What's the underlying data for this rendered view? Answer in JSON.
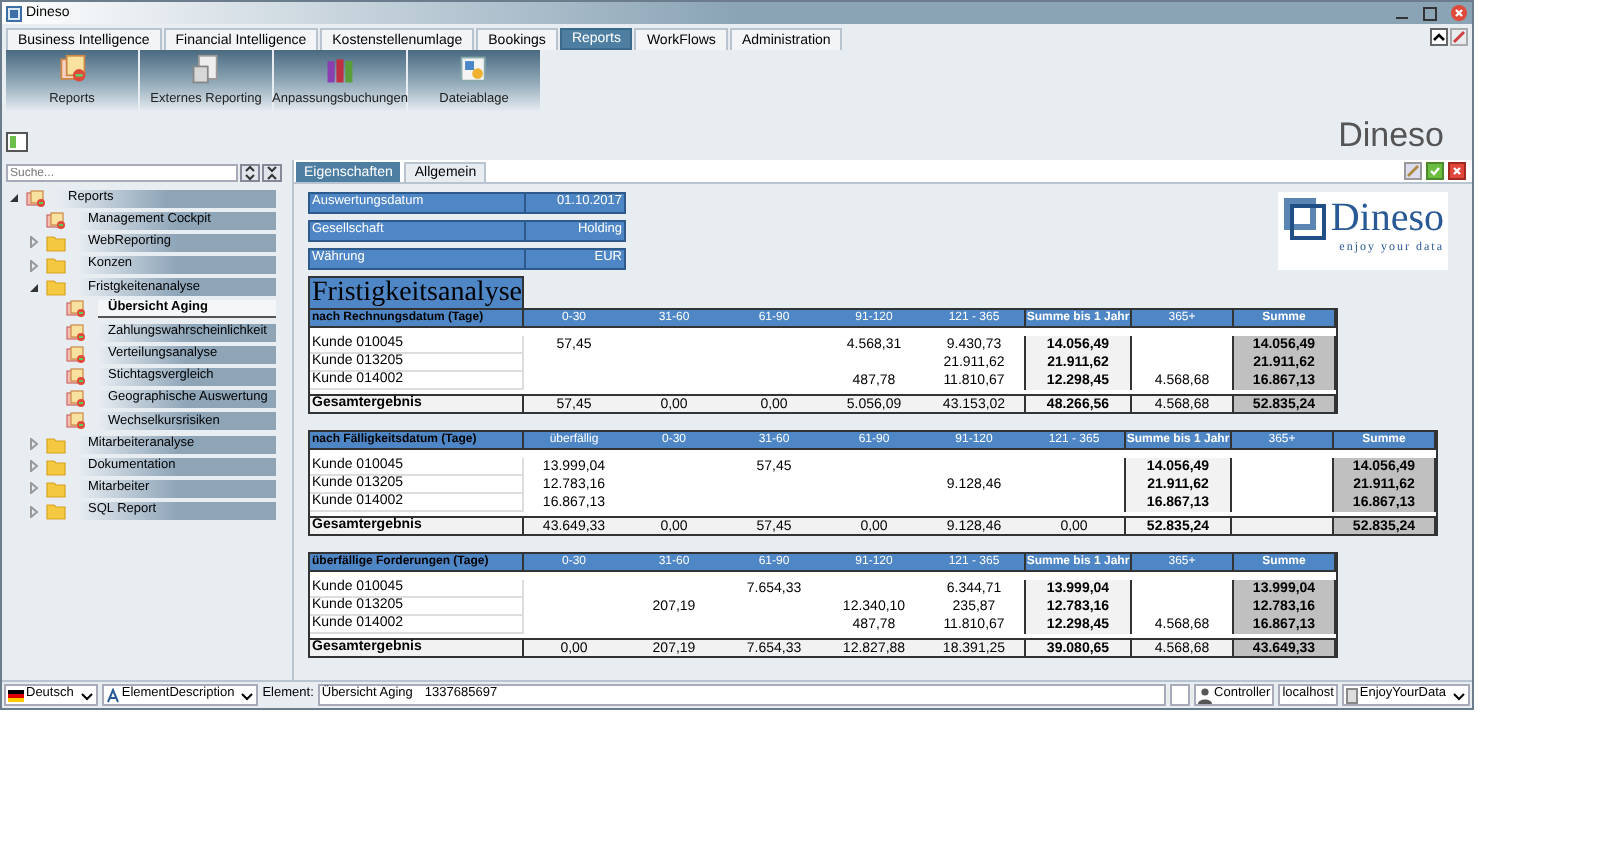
{
  "window": {
    "title": "Dineso"
  },
  "main_tabs": [
    {
      "label": "Business Intelligence",
      "selected": false
    },
    {
      "label": "Financial Intelligence",
      "selected": false
    },
    {
      "label": "Kostenstellenumlage",
      "selected": false
    },
    {
      "label": "Bookings",
      "selected": false
    },
    {
      "label": "Reports",
      "selected": true
    },
    {
      "label": "WorkFlows",
      "selected": false
    },
    {
      "label": "Administration",
      "selected": false
    }
  ],
  "ribbon": [
    {
      "label": "Reports",
      "kind": "reports"
    },
    {
      "label": "Externes Reporting",
      "kind": "external"
    },
    {
      "label": "Anpassungsbuchungen",
      "kind": "books"
    },
    {
      "label": "Dateiablage",
      "kind": "files"
    }
  ],
  "brand": "Dineso",
  "sidebar": {
    "search": {
      "placeholder": "Suche..."
    },
    "tree": [
      {
        "label": "Reports",
        "kind": "report",
        "expanded": true,
        "selected": false,
        "children": [
          {
            "label": "Management Cockpit",
            "kind": "report",
            "selected": false
          },
          {
            "label": "WebReporting",
            "kind": "folder",
            "expanded": false,
            "selected": false
          },
          {
            "label": "Konzen",
            "kind": "folder",
            "expanded": false,
            "selected": false
          },
          {
            "label": "Fristgkeitenanalyse",
            "kind": "folder",
            "expanded": true,
            "selected": false,
            "children": [
              {
                "label": "Übersicht Aging",
                "kind": "report",
                "selected": true
              },
              {
                "label": "Zahlungswahrscheinlichkeit",
                "kind": "report",
                "selected": false
              },
              {
                "label": "Verteilungsanalyse",
                "kind": "report",
                "selected": false
              },
              {
                "label": "Stichtagsvergleich",
                "kind": "report",
                "selected": false
              },
              {
                "label": "Geographische Auswertung",
                "kind": "report",
                "selected": false
              },
              {
                "label": "Wechselkursrisiken",
                "kind": "report",
                "selected": false
              }
            ]
          },
          {
            "label": "Mitarbeiteranalyse",
            "kind": "folder",
            "expanded": false,
            "selected": false
          },
          {
            "label": "Dokumentation",
            "kind": "folder",
            "expanded": false,
            "selected": false
          },
          {
            "label": "Mitarbeiter",
            "kind": "folder",
            "expanded": false,
            "selected": false
          },
          {
            "label": "SQL Report",
            "kind": "folder",
            "expanded": false,
            "selected": false
          }
        ]
      }
    ]
  },
  "panel_tabs": [
    {
      "label": "Eigenschaften",
      "selected": true
    },
    {
      "label": "Allgemein",
      "selected": false
    }
  ],
  "filters": [
    {
      "label": "Auswertungsdatum",
      "value": "01.10.2017"
    },
    {
      "label": "Gesellschaft",
      "value": "Holding"
    },
    {
      "label": "Währung",
      "value": "EUR"
    }
  ],
  "report": {
    "title": "Fristigkeitsanalyse",
    "logo": {
      "name": "Dineso",
      "tagline": "enjoy your data"
    },
    "tables": [
      {
        "heading": "nach Rechnungsdatum (Tage)",
        "columns": [
          {
            "label": "0-30",
            "kind": "bucket"
          },
          {
            "label": "31-60",
            "kind": "bucket"
          },
          {
            "label": "61-90",
            "kind": "bucket"
          },
          {
            "label": "91-120",
            "kind": "bucket"
          },
          {
            "label": "121 - 365",
            "kind": "bucket"
          },
          {
            "label": "Summe bis 1 Jahr",
            "kind": "subtotal"
          },
          {
            "label": "365+",
            "kind": "bucket"
          },
          {
            "label": "Summe",
            "kind": "total"
          }
        ],
        "rows": [
          {
            "label": "Kunde 010045",
            "cells": [
              "57,45",
              null,
              null,
              "4.568,31",
              "9.430,73",
              "14.056,49",
              null,
              "14.056,49"
            ]
          },
          {
            "label": "Kunde 013205",
            "cells": [
              null,
              null,
              null,
              null,
              "21.911,62",
              "21.911,62",
              null,
              "21.911,62"
            ]
          },
          {
            "label": "Kunde 014002",
            "cells": [
              null,
              null,
              null,
              "487,78",
              "11.810,67",
              "12.298,45",
              "4.568,68",
              "16.867,13"
            ]
          }
        ],
        "total": {
          "label": "Gesamtergebnis",
          "cells": [
            "57,45",
            "0,00",
            "0,00",
            "5.056,09",
            "43.153,02",
            "48.266,56",
            "4.568,68",
            "52.835,24"
          ]
        }
      },
      {
        "heading": "nach Fälligkeitsdatum (Tage)",
        "columns": [
          {
            "label": "überfällig",
            "kind": "bucket"
          },
          {
            "label": "0-30",
            "kind": "bucket"
          },
          {
            "label": "31-60",
            "kind": "bucket"
          },
          {
            "label": "61-90",
            "kind": "bucket"
          },
          {
            "label": "91-120",
            "kind": "bucket"
          },
          {
            "label": "121 - 365",
            "kind": "bucket"
          },
          {
            "label": "Summe bis 1 Jahr",
            "kind": "subtotal"
          },
          {
            "label": "365+",
            "kind": "bucket"
          },
          {
            "label": "Summe",
            "kind": "total"
          }
        ],
        "rows": [
          {
            "label": "Kunde 010045",
            "cells": [
              "13.999,04",
              null,
              "57,45",
              null,
              null,
              null,
              "14.056,49",
              null,
              "14.056,49"
            ]
          },
          {
            "label": "Kunde 013205",
            "cells": [
              "12.783,16",
              null,
              null,
              null,
              "9.128,46",
              null,
              "21.911,62",
              null,
              "21.911,62"
            ]
          },
          {
            "label": "Kunde 014002",
            "cells": [
              "16.867,13",
              null,
              null,
              null,
              null,
              null,
              "16.867,13",
              null,
              "16.867,13"
            ]
          }
        ],
        "total": {
          "label": "Gesamtergebnis",
          "cells": [
            "43.649,33",
            "0,00",
            "57,45",
            "0,00",
            "9.128,46",
            "0,00",
            "52.835,24",
            null,
            "52.835,24"
          ]
        }
      },
      {
        "heading": "überfällige Forderungen (Tage)",
        "columns": [
          {
            "label": "0-30",
            "kind": "bucket"
          },
          {
            "label": "31-60",
            "kind": "bucket"
          },
          {
            "label": "61-90",
            "kind": "bucket"
          },
          {
            "label": "91-120",
            "kind": "bucket"
          },
          {
            "label": "121 - 365",
            "kind": "bucket"
          },
          {
            "label": "Summe bis 1 Jahr",
            "kind": "subtotal"
          },
          {
            "label": "365+",
            "kind": "bucket"
          },
          {
            "label": "Summe",
            "kind": "total"
          }
        ],
        "rows": [
          {
            "label": "Kunde 010045",
            "cells": [
              null,
              null,
              "7.654,33",
              null,
              "6.344,71",
              "13.999,04",
              null,
              "13.999,04"
            ]
          },
          {
            "label": "Kunde 013205",
            "cells": [
              null,
              "207,19",
              null,
              "12.340,10",
              "235,87",
              "12.783,16",
              null,
              "12.783,16"
            ]
          },
          {
            "label": "Kunde 014002",
            "cells": [
              null,
              null,
              null,
              "487,78",
              "11.810,67",
              "12.298,45",
              "4.568,68",
              "16.867,13"
            ]
          }
        ],
        "total": {
          "label": "Gesamtergebnis",
          "cells": [
            "0,00",
            "207,19",
            "7.654,33",
            "12.827,88",
            "18.391,25",
            "39.080,65",
            "4.568,68",
            "43.649,33"
          ]
        }
      }
    ]
  },
  "status_bar": {
    "language": "Deutsch",
    "description_mode": "ElementDescription",
    "element_label": "Element:",
    "element_value": "Übersicht Aging",
    "element_id": "1337685697",
    "user": "Controller",
    "server": "localhost",
    "database": "EnjoyYourData"
  }
}
